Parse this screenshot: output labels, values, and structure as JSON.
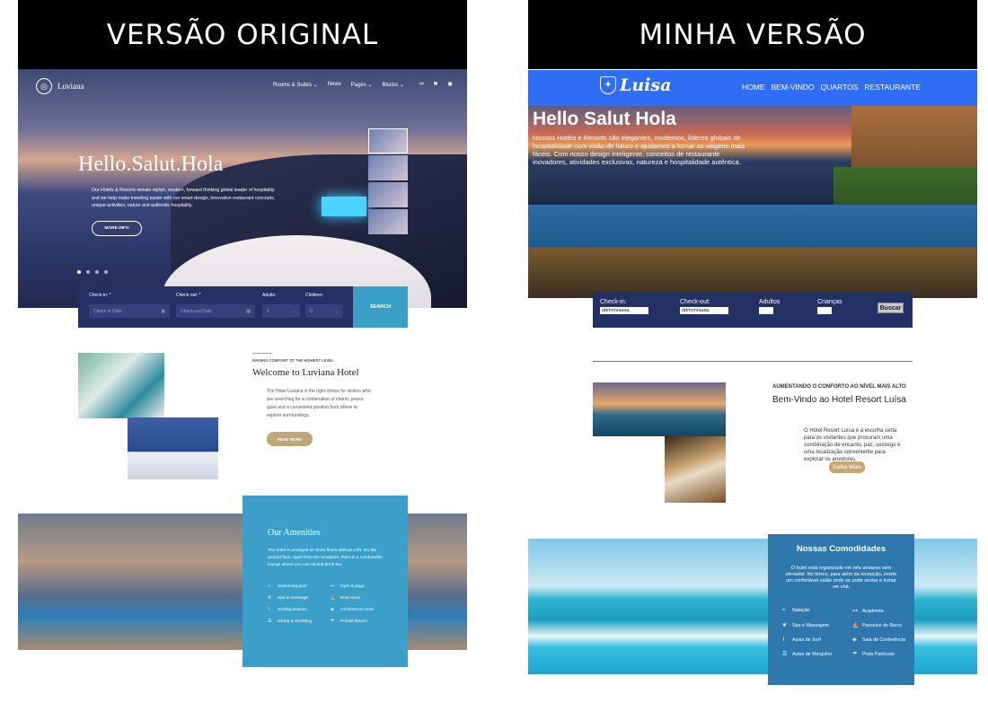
{
  "left": {
    "banner": "VERSÃO ORIGINAL",
    "logo": "Luviana",
    "nav": [
      "Rooms & Suites ⌄",
      "News",
      "Pages ⌄",
      "Blocks ⌄"
    ],
    "hero": {
      "title": "Hello.Salut.Hola",
      "text": "Our Hotels & Resorts remain stylish, modern, forward thinking global leader of hospitality and we help make traveling easier with our smart design, innovative restaurant concepts, unique activities, nature and authentic hospitality.",
      "button": "MORE INFO"
    },
    "booking": {
      "checkin_label": "Check-in: *",
      "checkin_placeholder": "Check-in Date",
      "checkout_label": "Check-out: *",
      "checkout_placeholder": "Check-out Date",
      "adults_label": "Adults:",
      "adults_value": "1",
      "children_label": "Children:",
      "children_value": "0",
      "search": "SEARCH"
    },
    "welcome": {
      "kicker": "RAISING COMFORT TO THE HIGHEST LEVEL",
      "title": "Welcome to Luviana Hotel",
      "text": "The Hotel Luviana is the right choice for visitors who are searching for a combination of charm, peace, quiet and a convenient position from where to explore surroundings.",
      "button": "READ MORE"
    },
    "amenities": {
      "title": "Our Amenities",
      "text": "The hotel is arranged on three floors without a lift. On the ground floor, apart from the reception, there is a comfortable lounge where you can sit and drink tea.",
      "items": [
        "Swimming pool",
        "Gym & yoga",
        "Spa & massage",
        "Boat tours",
        "Surfing lessons",
        "Conference room",
        "Diving & snorkling",
        "Private Beach"
      ]
    }
  },
  "right": {
    "banner": "MINHA VERSÃO",
    "logo": "Luisa",
    "nav": [
      "HOME",
      "BEM-VINDO",
      "QUARTOS",
      "RESTAURANTE"
    ],
    "hero": {
      "title": "Hello Salut Hola",
      "text": "Nossos Hotéis e Resorts são elegantes, modernos, líderes globais de hospitalidade com visão de futuro e ajudamos a tornar as viagens mais fáceis. Com nosso design inteligente, conceitos de restaurante inovadores, atividades exclusivas, natureza e hospitalidade autêntica."
    },
    "booking": {
      "checkin_label": "Check-in:",
      "checkin_value": "dd/mm/aaaa",
      "checkout_label": "Check-out:",
      "checkout_value": "dd/mm/aaaa",
      "adults_label": "Adultos",
      "children_label": "Crianças",
      "search": "Buscar"
    },
    "welcome": {
      "kicker": "AUMENTANDO O CONFORTO AO NÍVEL MAIS ALTO",
      "title": "Bem-Vindo ao Hotel Resort Luísa",
      "text": "O Hotel Resort Luísa é a escolha certa para os visitantes que procuram uma combinação de encanto, paz, sossego e uma localização conveniente para explorar os arredores.",
      "button": "Saiba Mais"
    },
    "amenities": {
      "title": "Nossas Comodidades",
      "text": "O hotel está organizado em três andares sem elevador. No térreo, para além da recepção, existe um confortável salão onde se pode sentar e tomar um chá.",
      "items": [
        "Natação",
        "Academia",
        "Spa e Massagem",
        "Passeios de Barco",
        "Aulas de Surf",
        "Sala de Conferência",
        "Aulas de Mergulho",
        "Praia Particular"
      ]
    }
  }
}
